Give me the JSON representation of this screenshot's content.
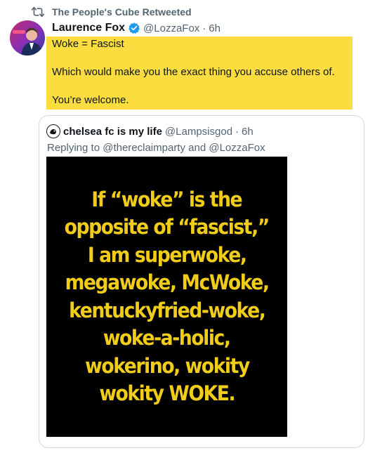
{
  "retweet": {
    "text": "The People's Cube Retweeted",
    "icon": "retweet-icon"
  },
  "tweet": {
    "author_name": "Laurence Fox",
    "author_handle": "@LozzaFox",
    "separator": "·",
    "time": "6h",
    "verified_color": "#1d9bf0",
    "highlight_color": "#fbdd3f",
    "lines": [
      "Woke = Fascist",
      "Which would make you the exact thing you accuse others of.",
      "You’re welcome."
    ]
  },
  "quote": {
    "author_name": "chelsea fc is my life",
    "author_handle": "@Lampsisgod",
    "separator": "·",
    "time": "6h",
    "replying": "Replying to @thereclaimparty and @LozzaFox",
    "meme": {
      "text_color": "#f1cd1b",
      "background": "#000000",
      "lines": [
        "If “woke” is the",
        "opposite of “fascist,”",
        "I am superwoke,",
        "megawoke, McWoke,",
        "kentuckyfried-woke,",
        "woke-a-holic,",
        "wokerino, wokity",
        "wokity WOKE."
      ]
    }
  }
}
